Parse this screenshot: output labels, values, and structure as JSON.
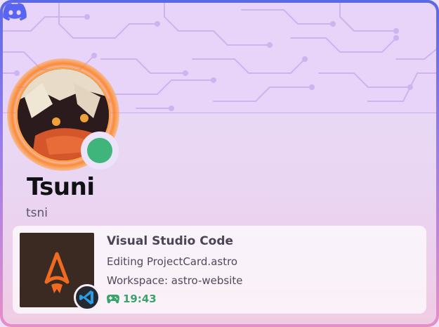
{
  "profile": {
    "display_name": "Tsuni",
    "username": "tsni",
    "status": "online",
    "status_color": "#3fb47b"
  },
  "brand": {
    "logo": "discord-icon",
    "color": "#5865f2"
  },
  "activity": {
    "app_name": "Visual Studio Code",
    "details": "Editing ProjectCard.astro",
    "state": "Workspace: astro-website",
    "elapsed": "19:43",
    "large_image_icon": "astro-icon",
    "small_image_icon": "vscode-icon",
    "game_icon": "gamepad-icon"
  },
  "colors": {
    "accent_top": "#5b68e6",
    "accent_bottom": "#e68fc6",
    "elapsed_green": "#3aa36c"
  }
}
